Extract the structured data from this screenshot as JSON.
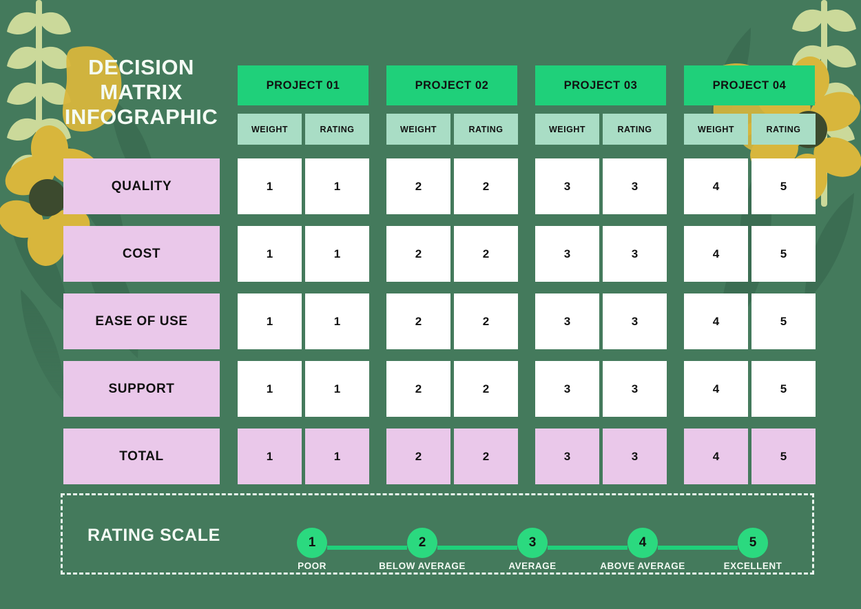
{
  "title": "DECISION MATRIX INFOGRAPHIC",
  "title_lines": [
    "DECISION",
    "MATRIX",
    "INFOGRAPHIC"
  ],
  "colors": {
    "background": "#447a5c",
    "project_header": "#1fd07a",
    "sub_header": "#a9ddc5",
    "row_label": "#eac8ea",
    "cell": "#ffffff",
    "total_cell": "#eac8ea",
    "text_light": "#f4fbf4",
    "text_dark": "#111111",
    "flower_petal": "#d8b63c",
    "flower_center": "#3c4a2e",
    "leaf_light": "#cbd99a",
    "leaf_dark": "#3b6d52"
  },
  "columns": [
    {
      "label": "PROJECT 01",
      "sub": [
        "WEIGHT",
        "RATING"
      ]
    },
    {
      "label": "PROJECT 02",
      "sub": [
        "WEIGHT",
        "RATING"
      ]
    },
    {
      "label": "PROJECT 03",
      "sub": [
        "WEIGHT",
        "RATING"
      ]
    },
    {
      "label": "PROJECT 04",
      "sub": [
        "WEIGHT",
        "RATING"
      ]
    }
  ],
  "rows": [
    {
      "label": "QUALITY",
      "values": [
        "1",
        "1",
        "2",
        "2",
        "3",
        "3",
        "4",
        "5"
      ],
      "is_total": false
    },
    {
      "label": "COST",
      "values": [
        "1",
        "1",
        "2",
        "2",
        "3",
        "3",
        "4",
        "5"
      ],
      "is_total": false
    },
    {
      "label": "EASE OF USE",
      "values": [
        "1",
        "1",
        "2",
        "2",
        "3",
        "3",
        "4",
        "5"
      ],
      "is_total": false
    },
    {
      "label": "SUPPORT",
      "values": [
        "1",
        "1",
        "2",
        "2",
        "3",
        "3",
        "4",
        "5"
      ],
      "is_total": false
    },
    {
      "label": "TOTAL",
      "values": [
        "1",
        "1",
        "2",
        "2",
        "3",
        "3",
        "4",
        "5"
      ],
      "is_total": true
    }
  ],
  "rating_scale": {
    "title": "RATING SCALE",
    "nodes": [
      {
        "number": "1",
        "label": "POOR"
      },
      {
        "number": "2",
        "label": "BELOW AVERAGE"
      },
      {
        "number": "3",
        "label": "AVERAGE"
      },
      {
        "number": "4",
        "label": "ABOVE AVERAGE"
      },
      {
        "number": "5",
        "label": "EXCELLENT"
      }
    ]
  },
  "chart_data": {
    "type": "table",
    "title": "DECISION MATRIX INFOGRAPHIC",
    "row_header": "",
    "categories": [
      "QUALITY",
      "COST",
      "EASE OF USE",
      "SUPPORT",
      "TOTAL"
    ],
    "column_groups": [
      "PROJECT 01",
      "PROJECT 02",
      "PROJECT 03",
      "PROJECT 04"
    ],
    "sub_columns": [
      "WEIGHT",
      "RATING"
    ],
    "series": [
      {
        "name": "PROJECT 01 WEIGHT",
        "values": [
          1,
          1,
          1,
          1,
          1
        ]
      },
      {
        "name": "PROJECT 01 RATING",
        "values": [
          1,
          1,
          1,
          1,
          1
        ]
      },
      {
        "name": "PROJECT 02 WEIGHT",
        "values": [
          2,
          2,
          2,
          2,
          2
        ]
      },
      {
        "name": "PROJECT 02 RATING",
        "values": [
          2,
          2,
          2,
          2,
          2
        ]
      },
      {
        "name": "PROJECT 03 WEIGHT",
        "values": [
          3,
          3,
          3,
          3,
          3
        ]
      },
      {
        "name": "PROJECT 03 RATING",
        "values": [
          3,
          3,
          3,
          3,
          3
        ]
      },
      {
        "name": "PROJECT 04 WEIGHT",
        "values": [
          4,
          4,
          4,
          4,
          4
        ]
      },
      {
        "name": "PROJECT 04 RATING",
        "values": [
          5,
          5,
          5,
          5,
          5
        ]
      }
    ],
    "legend": {
      "name": "RATING SCALE",
      "entries": [
        {
          "value": 1,
          "label": "POOR"
        },
        {
          "value": 2,
          "label": "BELOW AVERAGE"
        },
        {
          "value": 3,
          "label": "AVERAGE"
        },
        {
          "value": 4,
          "label": "ABOVE AVERAGE"
        },
        {
          "value": 5,
          "label": "EXCELLENT"
        }
      ]
    }
  }
}
